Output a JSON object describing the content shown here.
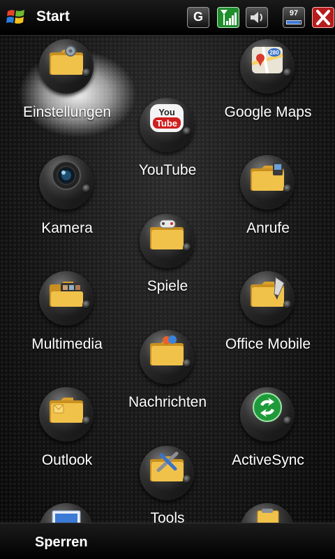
{
  "topbar": {
    "title": "Start",
    "network_label": "G",
    "battery_level": "97",
    "battery_fraction": 0.97
  },
  "icons": {
    "windows_logo": "windows-logo-icon",
    "network": "network-g-icon",
    "signal": "signal-icon",
    "volume": "volume-icon",
    "battery": "battery-icon",
    "close": "close-icon"
  },
  "colors": {
    "folder": "#e8b23a",
    "signal_green": "#1f8f2e",
    "close_red": "#b71c1c"
  },
  "items": [
    {
      "label": "Einstellungen",
      "icon": "settings-folder-icon",
      "selected": true
    },
    {
      "label": "YouTube",
      "icon": "youtube-icon"
    },
    {
      "label": "Google Maps",
      "icon": "google-maps-icon"
    },
    {
      "label": "Kamera",
      "icon": "camera-icon"
    },
    {
      "label": "Spiele",
      "icon": "games-folder-icon"
    },
    {
      "label": "Anrufe",
      "icon": "calls-folder-icon"
    },
    {
      "label": "Multimedia",
      "icon": "multimedia-folder-icon"
    },
    {
      "label": "Nachrichten",
      "icon": "messages-folder-icon"
    },
    {
      "label": "Office Mobile",
      "icon": "office-folder-icon"
    },
    {
      "label": "Outlook",
      "icon": "outlook-folder-icon"
    },
    {
      "label": "Tools",
      "icon": "tools-folder-icon"
    },
    {
      "label": "ActiveSync",
      "icon": "activesync-icon"
    }
  ],
  "bottombar": {
    "left_softkey": "Sperren"
  }
}
